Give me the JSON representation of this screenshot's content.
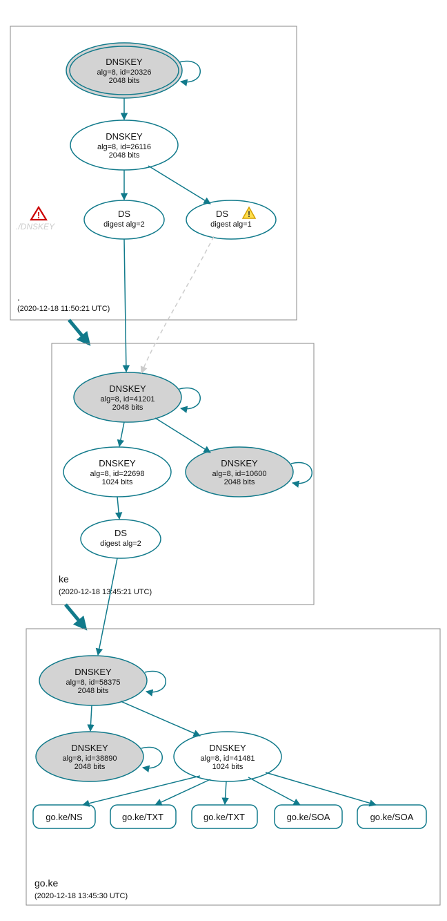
{
  "zones": {
    "root": {
      "label": ".",
      "ts": "(2020-12-18 11:50:21 UTC)"
    },
    "ke": {
      "label": "ke",
      "ts": "(2020-12-18 13:45:21 UTC)"
    },
    "goke": {
      "label": "go.ke",
      "ts": "(2020-12-18 13:45:30 UTC)"
    }
  },
  "nodes": {
    "root_ksk": {
      "t": "DNSKEY",
      "l2": "alg=8, id=20326",
      "l3": "2048 bits"
    },
    "root_zsk": {
      "t": "DNSKEY",
      "l2": "alg=8, id=26116",
      "l3": "2048 bits"
    },
    "root_ds2": {
      "t": "DS",
      "l2": "digest alg=2"
    },
    "root_ds1": {
      "t": "DS",
      "l2": "digest alg=1"
    },
    "ke_ksk": {
      "t": "DNSKEY",
      "l2": "alg=8, id=41201",
      "l3": "2048 bits"
    },
    "ke_zsk": {
      "t": "DNSKEY",
      "l2": "alg=8, id=22698",
      "l3": "1024 bits"
    },
    "ke_key2": {
      "t": "DNSKEY",
      "l2": "alg=8, id=10600",
      "l3": "2048 bits"
    },
    "ke_ds": {
      "t": "DS",
      "l2": "digest alg=2"
    },
    "goke_ksk": {
      "t": "DNSKEY",
      "l2": "alg=8, id=58375",
      "l3": "2048 bits"
    },
    "goke_key2": {
      "t": "DNSKEY",
      "l2": "alg=8, id=38890",
      "l3": "2048 bits"
    },
    "goke_zsk": {
      "t": "DNSKEY",
      "l2": "alg=8, id=41481",
      "l3": "1024 bits"
    },
    "rr_ns": "go.ke/NS",
    "rr_txt1": "go.ke/TXT",
    "rr_txt2": "go.ke/TXT",
    "rr_soa1": "go.ke/SOA",
    "rr_soa2": "go.ke/SOA"
  },
  "ghost": "./DNSKEY"
}
